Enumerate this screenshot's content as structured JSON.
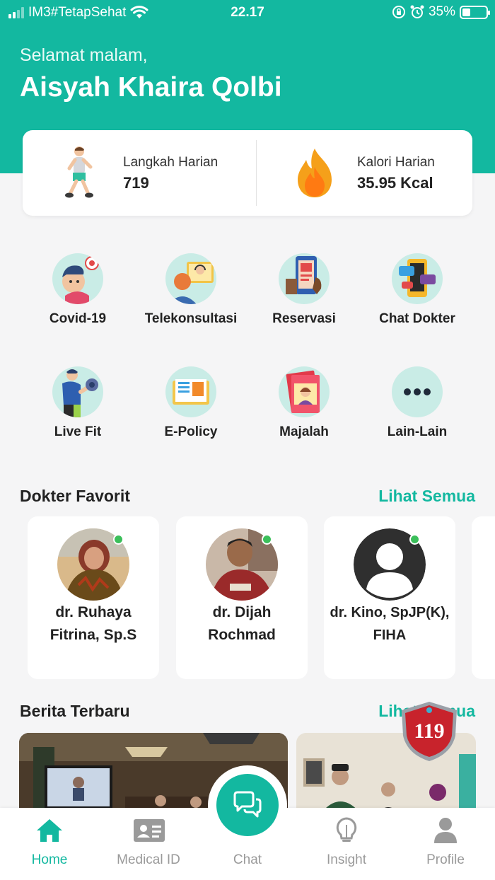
{
  "status_bar": {
    "carrier": "IM3#TetapSehat",
    "time": "22.17",
    "battery": "35%",
    "battery_level": 0.35
  },
  "header": {
    "greeting": "Selamat malam,",
    "user_name": "Aisyah Khaira Qolbi"
  },
  "stats": {
    "steps_label": "Langkah Harian",
    "steps_value": "719",
    "calories_label": "Kalori Harian",
    "calories_value": "35.95 Kcal"
  },
  "menu": [
    {
      "label": "Covid-19",
      "icon": "covid-icon"
    },
    {
      "label": "Telekonsultasi",
      "icon": "teleconsultation-icon"
    },
    {
      "label": "Reservasi",
      "icon": "reservation-icon"
    },
    {
      "label": "Chat Dokter",
      "icon": "chat-doctor-icon"
    },
    {
      "label": "Live Fit",
      "icon": "live-fit-icon"
    },
    {
      "label": "E-Policy",
      "icon": "e-policy-icon"
    },
    {
      "label": "Majalah",
      "icon": "magazine-icon"
    },
    {
      "label": "Lain-Lain",
      "icon": "more-icon"
    }
  ],
  "favorite_doctors": {
    "title": "Dokter Favorit",
    "see_all": "Lihat Semua",
    "doctors": [
      {
        "name": "dr. Ruhaya Fitrina, Sp.S",
        "online": true
      },
      {
        "name": "dr. Dijah Rochmad",
        "online": true
      },
      {
        "name": "dr. Kino, SpJP(K), FIHA",
        "online": true
      }
    ]
  },
  "news": {
    "title": "Berita Terbaru",
    "see_all": "Lihat Semua",
    "badge_text": "119"
  },
  "tabs": [
    {
      "label": "Home",
      "icon": "home-icon",
      "active": true
    },
    {
      "label": "Medical ID",
      "icon": "id-card-icon",
      "active": false
    },
    {
      "label": "Chat",
      "icon": "chat-icon",
      "active": false
    },
    {
      "label": "Insight",
      "icon": "lightbulb-icon",
      "active": false
    },
    {
      "label": "Profile",
      "icon": "person-icon",
      "active": false
    }
  ],
  "colors": {
    "primary": "#13b8a0",
    "background": "#f5f5f6",
    "online": "#3bbf5a",
    "badge_red": "#c8232c"
  }
}
